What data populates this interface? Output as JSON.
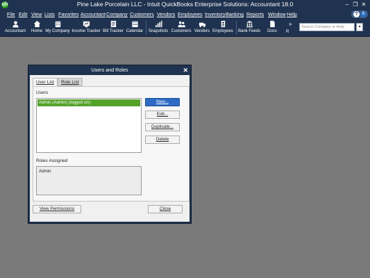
{
  "window": {
    "title": "Pine Lake Porcelain LLC  - Intuit QuickBooks Enterprise Solutions: Accountant 18.0",
    "logo_text": "qb",
    "minimize_glyph": "–",
    "restore_glyph": "❐",
    "close_glyph": "✕"
  },
  "menubar": {
    "items": [
      "File",
      "Edit",
      "View",
      "Lists",
      "Favorites",
      "Accountant",
      "Company",
      "Customers",
      "Vendors",
      "Employees",
      "Inventory",
      "Banking",
      "Reports",
      "Window",
      "Help"
    ],
    "help_glyph": "?",
    "notification_count": "6"
  },
  "iconbar": {
    "buttons": [
      {
        "label": "Accountant",
        "icon": "accountant-icon"
      },
      {
        "label": "Home",
        "icon": "home-icon"
      },
      {
        "label": "My Company",
        "icon": "building-icon"
      },
      {
        "label": "Income Tracker",
        "icon": "income-tracker-icon"
      },
      {
        "label": "Bill Tracker",
        "icon": "bill-tracker-icon"
      },
      {
        "label": "Calendar",
        "icon": "calendar-icon"
      },
      {
        "label": "Snapshots",
        "icon": "snapshots-icon"
      },
      {
        "label": "Customers",
        "icon": "customers-icon"
      },
      {
        "label": "Vendors",
        "icon": "vendors-icon"
      },
      {
        "label": "Employees",
        "icon": "employees-icon"
      },
      {
        "label": "Bank Feeds",
        "icon": "bank-icon"
      },
      {
        "label": "Docs",
        "icon": "docs-icon"
      }
    ],
    "more_glyph": "»",
    "more_label": "R",
    "search_placeholder": "Search Company or Help",
    "search_go_glyph": "▾"
  },
  "dialog": {
    "title": "Users and Roles",
    "close_glyph": "✕",
    "tabs": [
      {
        "label": "User List",
        "active": true
      },
      {
        "label": "Role List",
        "active": false
      }
    ],
    "users_label": "Users",
    "users": [
      {
        "name": "Admin (Admin) (logged on)",
        "selected": true
      }
    ],
    "buttons": {
      "new": "New...",
      "edit": "Edit...",
      "duplicate": "Duplicate...",
      "delete": "Delete"
    },
    "roles_label": "Roles Assigned",
    "roles": [
      "Admin"
    ],
    "view_permissions": "View Permissions",
    "close": "Close"
  },
  "colors": {
    "chrome": "#1f3350",
    "desktop": "#7a7a7a",
    "selection": "#54a22a",
    "primary_button": "#2e6bc6",
    "qb_green": "#2ca01c"
  }
}
